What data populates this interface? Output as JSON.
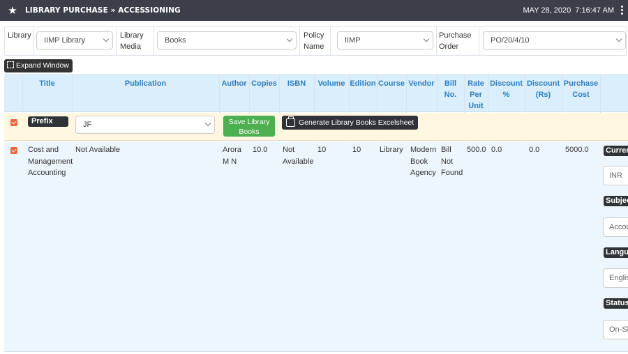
{
  "header": {
    "title": "LIBRARY PURCHASE » ACCESSIONING",
    "date": "MAY 28, 2020",
    "time": "7:16:47 AM",
    "star_icon": "star-icon",
    "menu_icon": "kebab-menu-icon"
  },
  "filters": {
    "library": {
      "label": "Library",
      "value": "IIMP Library"
    },
    "library_media": {
      "label_line1": "Library",
      "label_line2": "Media",
      "value": "Books"
    },
    "policy_name": {
      "label_line1": "Policy",
      "label_line2": "Name",
      "value": "IIMP"
    },
    "purchase_order": {
      "label_line1": "Purchase",
      "label_line2": "Order",
      "value": "PO/20/4/10"
    }
  },
  "expand_button": {
    "label": "Expand Window",
    "icon": "expand-icon"
  },
  "table": {
    "headers": {
      "title": "Title",
      "publication": "Publication",
      "author": "Author",
      "copies": "Copies",
      "isbn": "ISBN",
      "volume": "Volume",
      "edition": "Edition",
      "course": "Course",
      "vendor": "Vendor",
      "bill_l1": "Bill",
      "bill_l2": "No.",
      "rate_l1": "Rate",
      "rate_l2": "Per",
      "rate_l3": "Unit",
      "discp_l1": "Discount",
      "discp_l2": "%",
      "discr_l1": "Discount",
      "discr_l2": "(Rs)",
      "pc_l1": "Purchase",
      "pc_l2": "Cost"
    },
    "prefix_row": {
      "prefix_label": "Prefix",
      "prefix_value": "JF",
      "save_l1": "Save Library",
      "save_l2": "Books",
      "generate_label": "Generate Library Books Excelsheet"
    },
    "row": {
      "title_l1": "Cost and",
      "title_l2": "Management",
      "title_l3": "Accounting",
      "publication": "Not Available",
      "author_l1": "Arora",
      "author_l2": "M N",
      "copies": "10.0",
      "isbn_l1": "Not",
      "isbn_l2": "Available",
      "volume": "10",
      "edition": "10",
      "course": "Library",
      "vendor_l1": "Modern",
      "vendor_l2": "Book",
      "vendor_l3": "Agency",
      "bill_l1": "Bill",
      "bill_l2": "Not",
      "bill_l3": "Found",
      "rate": "500.0",
      "discount_pct": "0.0",
      "discount_rs": "0.0",
      "purchase_cost": "5000.0"
    },
    "side_fields": {
      "currency_label": "Curren",
      "currency_value": "INR",
      "subject_label": "Subjec",
      "subject_value": "Accou",
      "language_label": "Langu",
      "language_value": "Englis",
      "status_label": "Status",
      "status_value": "On-Sh"
    }
  }
}
